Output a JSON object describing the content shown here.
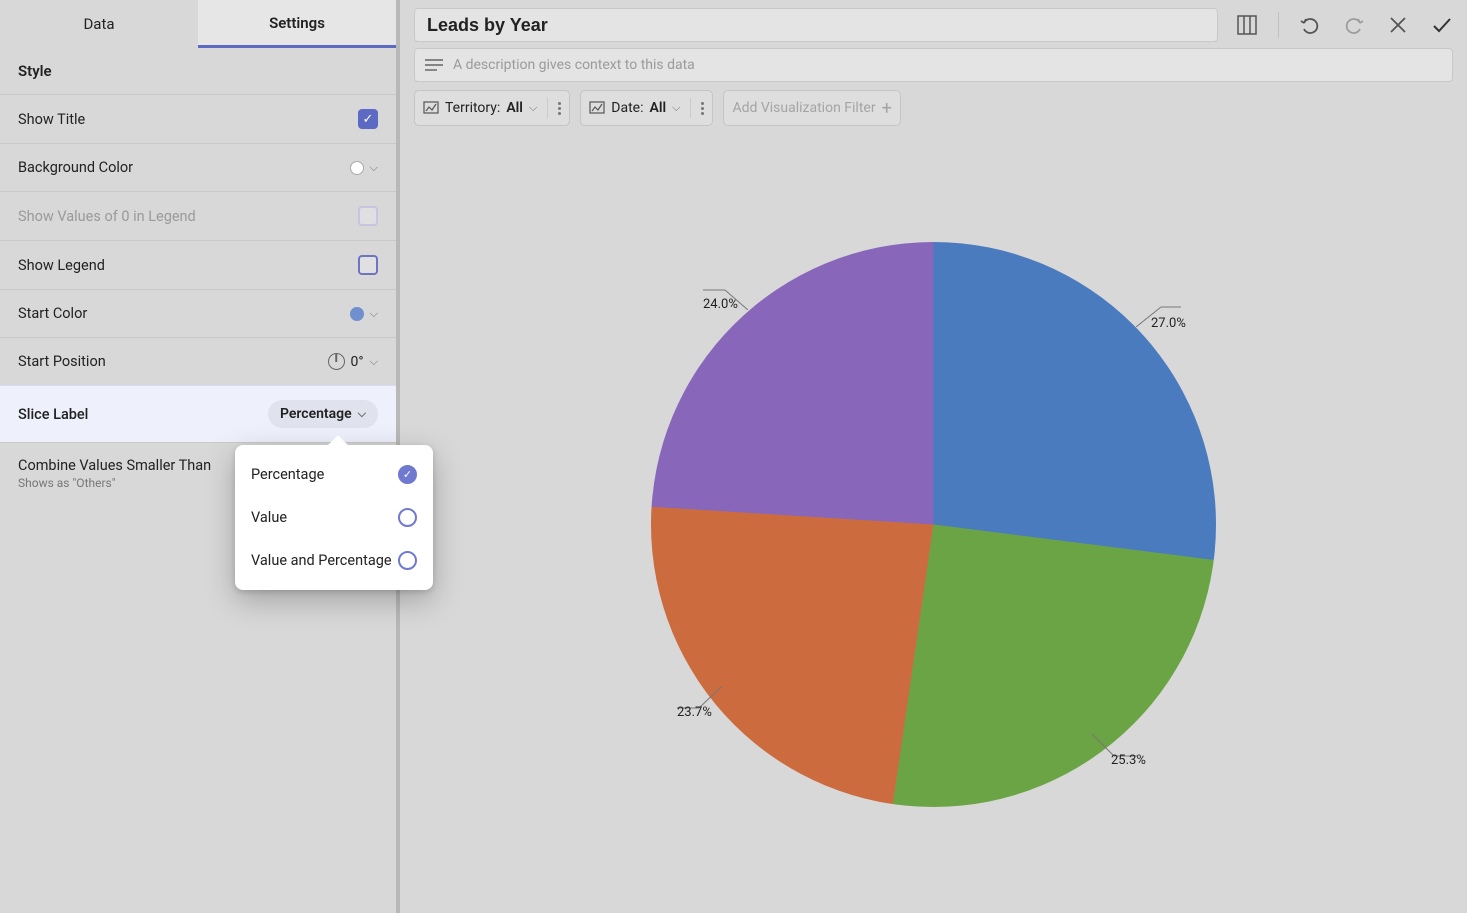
{
  "tabs": {
    "data": "Data",
    "settings": "Settings",
    "active": "Settings"
  },
  "section": {
    "style": "Style"
  },
  "rows": {
    "show_title": "Show Title",
    "background_color": "Background Color",
    "show_zero": "Show Values of 0 in Legend",
    "show_legend": "Show Legend",
    "start_color": "Start Color",
    "start_position": "Start Position",
    "start_position_value": "0°",
    "slice_label": "Slice Label",
    "slice_label_value": "Percentage",
    "combine": "Combine Values Smaller Than",
    "combine_sub": "Shows as \"Others\""
  },
  "popover": {
    "percentage": "Percentage",
    "value": "Value",
    "value_and_pct": "Value and Percentage"
  },
  "header": {
    "title": "Leads by Year",
    "description_placeholder": "A description gives context to this data"
  },
  "filters": {
    "territory_label": "Territory:",
    "territory_value": "All",
    "date_label": "Date:",
    "date_value": "All",
    "add_filter": "Add Visualization Filter"
  },
  "chart_data": {
    "type": "pie",
    "title": "Leads by Year",
    "slices": [
      {
        "label": "27.0%",
        "value_pct": 27.0,
        "color": "#4a7bbf"
      },
      {
        "label": "25.3%",
        "value_pct": 25.3,
        "color": "#6ba445"
      },
      {
        "label": "23.7%",
        "value_pct": 23.7,
        "color": "#cc6b3e"
      },
      {
        "label": "24.0%",
        "value_pct": 24.0,
        "color": "#8867bb"
      }
    ]
  }
}
